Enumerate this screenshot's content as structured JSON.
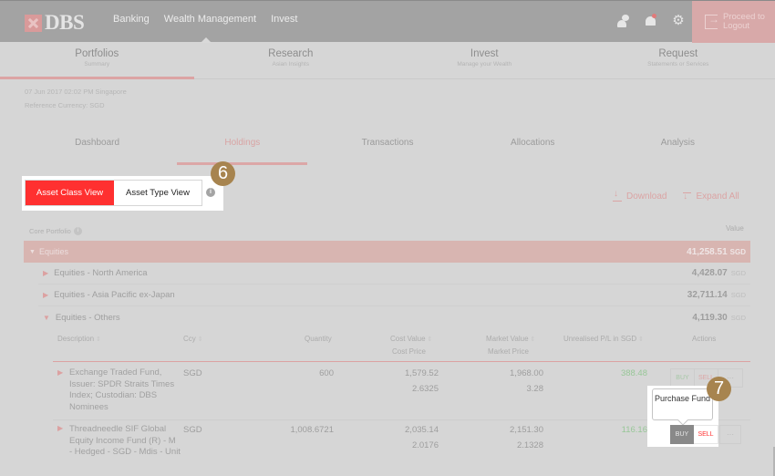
{
  "header": {
    "logo_text": "DBS",
    "nav": [
      "Banking",
      "Wealth Management",
      "Invest"
    ],
    "icons": [
      "chat-support-icon",
      "notification-bell-icon",
      "settings-gear-icon"
    ],
    "logout_line1": "Proceed to",
    "logout_line2": "Logout"
  },
  "sections": [
    {
      "title": "Portfolios",
      "subtitle": "Summary",
      "active": true
    },
    {
      "title": "Research",
      "subtitle": "Asian Insights"
    },
    {
      "title": "Invest",
      "subtitle": "Manage your Wealth"
    },
    {
      "title": "Request",
      "subtitle": "Statements or Services"
    }
  ],
  "meta": {
    "timestamp": "07 Jun 2017 02:02 PM Singapore",
    "ref_currency": "Reference Currency: SGD"
  },
  "subtabs": [
    "Dashboard",
    "Holdings",
    "Transactions",
    "Allocations",
    "Analysis"
  ],
  "active_subtab": "Holdings",
  "view_toggle": {
    "options": [
      "Asset Class View",
      "Asset Type View"
    ],
    "selected": "Asset Class View",
    "info": "i"
  },
  "annotations": {
    "badge1": "6",
    "badge2": "7"
  },
  "toolbar": {
    "download": "Download",
    "expand_all": "Expand All"
  },
  "portfolio": {
    "label": "Core Portfolio",
    "value_header": "Value",
    "group": {
      "name": "Equities",
      "value": "41,258.51",
      "currency": "SGD"
    },
    "subgroups": [
      {
        "name": "Equities - North America",
        "value": "4,428.07",
        "currency": "SGD",
        "expanded": false
      },
      {
        "name": "Equities - Asia Pacific ex-Japan",
        "value": "32,711.14",
        "currency": "SGD",
        "expanded": false
      },
      {
        "name": "Equities - Others",
        "value": "4,119.30",
        "currency": "SGD",
        "expanded": true
      }
    ]
  },
  "table": {
    "headers": {
      "description": "Description",
      "ccy": "Ccy",
      "quantity": "Quantity",
      "cost_value": "Cost Value",
      "cost_price": "Cost Price",
      "market_value": "Market Value",
      "market_price": "Market Price",
      "pl": "Unrealised P/L in SGD",
      "actions": "Actions"
    },
    "rows": [
      {
        "description": "Exchange Traded Fund, Issuer: SPDR Straits Times Index; Custodian: DBS Nominees",
        "ccy": "SGD",
        "quantity": "600",
        "cost_value": "1,579.52",
        "cost_price": "2.6325",
        "market_value": "1,968.00",
        "market_price": "3.28",
        "pl": "388.48"
      },
      {
        "description": "Threadneedle SIF Global Equity Income Fund (R) - M - Hedged - SGD - Mdis - Unit",
        "ccy": "SGD",
        "quantity": "1,008.6721",
        "cost_value": "2,035.14",
        "cost_price": "2.0176",
        "market_value": "2,151.30",
        "market_price": "2.1328",
        "pl": "116.16"
      }
    ],
    "buttons": {
      "buy": "BUY",
      "sell": "SELL",
      "more": "···"
    }
  },
  "tooltip": {
    "text": "Purchase Fund"
  },
  "colors": {
    "accent": "#ff3030",
    "gain": "#98c798",
    "badge": "#a7844f"
  }
}
